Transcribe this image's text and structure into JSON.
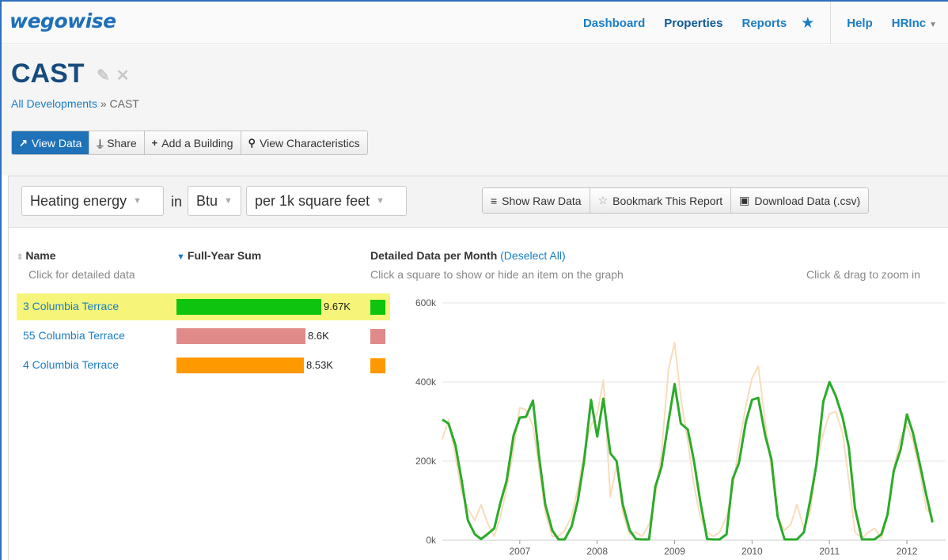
{
  "nav": {
    "logo": "wegowise",
    "links": [
      "Dashboard",
      "Properties",
      "Reports"
    ],
    "help": "Help",
    "user": "HRInc"
  },
  "page": {
    "title": "CAST",
    "breadcrumb_link": "All Developments",
    "breadcrumb_sep": "»",
    "breadcrumb_current": "CAST"
  },
  "actions": {
    "view_data": "View Data",
    "share": "Share",
    "add_building": "Add a Building",
    "view_characteristics": "View Characteristics"
  },
  "controls": {
    "metric": "Heating energy",
    "in_label": "in",
    "unit": "Btu",
    "normalization": "per 1k square feet",
    "show_raw": "Show Raw Data",
    "bookmark": "Bookmark This Report",
    "download": "Download Data (.csv)"
  },
  "columns": {
    "name": "Name",
    "name_sub": "Click for detailed data",
    "sum": "Full-Year Sum",
    "detail": "Detailed Data per Month",
    "deselect": "(Deselect All)",
    "detail_sub": "Click a square to show or hide an item on the graph",
    "zoom_hint": "Click & drag to zoom in"
  },
  "rows": [
    {
      "name": "3 Columbia Terrace",
      "value": 9670,
      "label": "9.67K",
      "color": "#0fc40f",
      "highlighted": true
    },
    {
      "name": "55 Columbia Terrace",
      "value": 8600,
      "label": "8.6K",
      "color": "#e08a8a",
      "highlighted": false
    },
    {
      "name": "4 Columbia Terrace",
      "value": 8530,
      "label": "8.53K",
      "color": "#ff9900",
      "highlighted": false
    }
  ],
  "colors": {
    "accent": "#1a7dc4",
    "highlight": "#f6f57a",
    "series_green": "#2bab2b",
    "series_faint": "#f9dcbc"
  },
  "chart_data": {
    "type": "line",
    "ylim": [
      0,
      600000
    ],
    "y_ticks": [
      0,
      200000,
      400000,
      600000
    ],
    "y_tick_labels": [
      "0k",
      "200k",
      "400k",
      "600k"
    ],
    "x_range": [
      2006.0,
      2012.5
    ],
    "x_ticks": [
      2007,
      2008,
      2009,
      2010,
      2011,
      2012
    ],
    "x_tick_labels": [
      "2007",
      "2008",
      "2009",
      "2010",
      "2011",
      "2012"
    ],
    "grid": true,
    "series": [
      {
        "color": "#2bab2b",
        "points": [
          [
            2006.0,
            305000
          ],
          [
            2006.08,
            295000
          ],
          [
            2006.17,
            240000
          ],
          [
            2006.25,
            150000
          ],
          [
            2006.33,
            50000
          ],
          [
            2006.42,
            15000
          ],
          [
            2006.5,
            3000
          ],
          [
            2006.58,
            15000
          ],
          [
            2006.67,
            30000
          ],
          [
            2006.75,
            95000
          ],
          [
            2006.83,
            150000
          ],
          [
            2006.92,
            265000
          ],
          [
            2007.0,
            310000
          ],
          [
            2007.08,
            312000
          ],
          [
            2007.17,
            353000
          ],
          [
            2007.25,
            210000
          ],
          [
            2007.33,
            90000
          ],
          [
            2007.42,
            25000
          ],
          [
            2007.5,
            2000
          ],
          [
            2007.58,
            2000
          ],
          [
            2007.67,
            35000
          ],
          [
            2007.75,
            100000
          ],
          [
            2007.83,
            200000
          ],
          [
            2007.92,
            355000
          ],
          [
            2008.0,
            262000
          ],
          [
            2008.08,
            358000
          ],
          [
            2008.17,
            220000
          ],
          [
            2008.25,
            200000
          ],
          [
            2008.33,
            90000
          ],
          [
            2008.42,
            25000
          ],
          [
            2008.5,
            3000
          ],
          [
            2008.58,
            2000
          ],
          [
            2008.67,
            2000
          ],
          [
            2008.75,
            135000
          ],
          [
            2008.83,
            185000
          ],
          [
            2008.92,
            300000
          ],
          [
            2009.0,
            395000
          ],
          [
            2009.08,
            295000
          ],
          [
            2009.17,
            280000
          ],
          [
            2009.25,
            200000
          ],
          [
            2009.33,
            100000
          ],
          [
            2009.42,
            3000
          ],
          [
            2009.5,
            2000
          ],
          [
            2009.58,
            2000
          ],
          [
            2009.67,
            15000
          ],
          [
            2009.75,
            155000
          ],
          [
            2009.83,
            195000
          ],
          [
            2009.92,
            300000
          ],
          [
            2010.0,
            355000
          ],
          [
            2010.08,
            360000
          ],
          [
            2010.17,
            265000
          ],
          [
            2010.25,
            205000
          ],
          [
            2010.33,
            60000
          ],
          [
            2010.42,
            2000
          ],
          [
            2010.5,
            2000
          ],
          [
            2010.58,
            2000
          ],
          [
            2010.67,
            20000
          ],
          [
            2010.75,
            100000
          ],
          [
            2010.83,
            190000
          ],
          [
            2010.92,
            350000
          ],
          [
            2011.0,
            400000
          ],
          [
            2011.08,
            365000
          ],
          [
            2011.17,
            310000
          ],
          [
            2011.25,
            235000
          ],
          [
            2011.33,
            80000
          ],
          [
            2011.42,
            2000
          ],
          [
            2011.5,
            2000
          ],
          [
            2011.58,
            2000
          ],
          [
            2011.67,
            15000
          ],
          [
            2011.75,
            65000
          ],
          [
            2011.83,
            175000
          ],
          [
            2011.92,
            230000
          ],
          [
            2012.0,
            318000
          ],
          [
            2012.08,
            270000
          ],
          [
            2012.17,
            190000
          ],
          [
            2012.25,
            115000
          ],
          [
            2012.33,
            45000
          ]
        ]
      },
      {
        "color": "#f9dcbc",
        "points": [
          [
            2006.0,
            255000
          ],
          [
            2006.08,
            305000
          ],
          [
            2006.17,
            210000
          ],
          [
            2006.25,
            120000
          ],
          [
            2006.33,
            80000
          ],
          [
            2006.42,
            50000
          ],
          [
            2006.5,
            90000
          ],
          [
            2006.58,
            45000
          ],
          [
            2006.67,
            10000
          ],
          [
            2006.75,
            60000
          ],
          [
            2006.83,
            130000
          ],
          [
            2006.92,
            230000
          ],
          [
            2007.0,
            335000
          ],
          [
            2007.08,
            330000
          ],
          [
            2007.17,
            290000
          ],
          [
            2007.25,
            180000
          ],
          [
            2007.33,
            70000
          ],
          [
            2007.42,
            10000
          ],
          [
            2007.5,
            10000
          ],
          [
            2007.58,
            25000
          ],
          [
            2007.67,
            60000
          ],
          [
            2007.75,
            130000
          ],
          [
            2007.83,
            220000
          ],
          [
            2007.92,
            290000
          ],
          [
            2008.0,
            320000
          ],
          [
            2008.08,
            405000
          ],
          [
            2008.17,
            110000
          ],
          [
            2008.25,
            190000
          ],
          [
            2008.33,
            70000
          ],
          [
            2008.42,
            15000
          ],
          [
            2008.5,
            20000
          ],
          [
            2008.58,
            10000
          ],
          [
            2008.67,
            40000
          ],
          [
            2008.75,
            110000
          ],
          [
            2008.83,
            220000
          ],
          [
            2008.92,
            430000
          ],
          [
            2009.0,
            500000
          ],
          [
            2009.08,
            360000
          ],
          [
            2009.17,
            250000
          ],
          [
            2009.25,
            140000
          ],
          [
            2009.33,
            60000
          ],
          [
            2009.42,
            20000
          ],
          [
            2009.5,
            10000
          ],
          [
            2009.58,
            20000
          ],
          [
            2009.67,
            60000
          ],
          [
            2009.75,
            130000
          ],
          [
            2009.83,
            240000
          ],
          [
            2009.92,
            340000
          ],
          [
            2010.0,
            410000
          ],
          [
            2010.08,
            440000
          ],
          [
            2010.17,
            300000
          ],
          [
            2010.25,
            180000
          ],
          [
            2010.33,
            60000
          ],
          [
            2010.42,
            25000
          ],
          [
            2010.5,
            40000
          ],
          [
            2010.58,
            90000
          ],
          [
            2010.67,
            30000
          ],
          [
            2010.75,
            70000
          ],
          [
            2010.83,
            190000
          ],
          [
            2010.92,
            270000
          ],
          [
            2011.0,
            320000
          ],
          [
            2011.08,
            325000
          ],
          [
            2011.17,
            270000
          ],
          [
            2011.25,
            150000
          ],
          [
            2011.33,
            20000
          ],
          [
            2011.42,
            5000
          ],
          [
            2011.5,
            20000
          ],
          [
            2011.58,
            30000
          ],
          [
            2011.67,
            5000
          ],
          [
            2011.75,
            60000
          ],
          [
            2011.83,
            180000
          ],
          [
            2011.92,
            260000
          ],
          [
            2012.0,
            290000
          ],
          [
            2012.08,
            250000
          ],
          [
            2012.17,
            170000
          ],
          [
            2012.25,
            80000
          ],
          [
            2012.33,
            60000
          ]
        ]
      }
    ]
  }
}
